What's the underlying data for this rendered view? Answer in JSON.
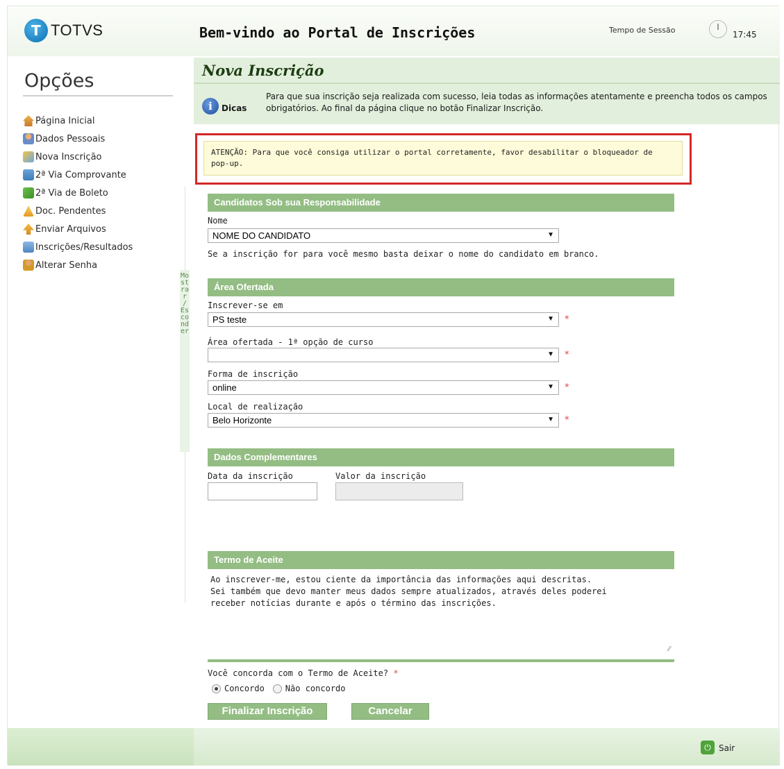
{
  "header": {
    "logo_text": "TOTVS",
    "welcome": "Bem-vindo ao Portal de Inscrições",
    "session_label": "Tempo de Sessão",
    "session_time": "17:45"
  },
  "sidebar": {
    "title": "Opções",
    "items": [
      {
        "label": "Página Inicial",
        "icon": "home-icon"
      },
      {
        "label": "Dados Pessoais",
        "icon": "user-icon"
      },
      {
        "label": "Nova Inscrição",
        "icon": "new-registration-icon"
      },
      {
        "label": "2ª Via Comprovante",
        "icon": "receipt-icon"
      },
      {
        "label": "2ª Via de Boleto",
        "icon": "boleto-icon"
      },
      {
        "label": "Doc. Pendentes",
        "icon": "pending-docs-icon"
      },
      {
        "label": "Enviar Arquivos",
        "icon": "upload-icon"
      },
      {
        "label": "Inscrições/Resultados",
        "icon": "results-icon"
      },
      {
        "label": "Alterar Senha",
        "icon": "key-icon"
      }
    ],
    "toggle_label": "Mostrar / Esconder"
  },
  "main": {
    "title": "Nova Inscrição",
    "tips_label": "Dicas",
    "tips_text": "Para que sua inscrição seja realizada com sucesso, leia todas as informações atentamente e preencha todos os campos obrigatórios. Ao final da página clique no botão Finalizar Inscrição.",
    "warning": "ATENÇÃO: Para que você consiga utilizar o portal corretamente, favor desabilitar o bloqueador de pop-up."
  },
  "candidates": {
    "section": "Candidatos Sob sua Responsabilidade",
    "name_label": "Nome",
    "name_value": "NOME DO CANDIDATO",
    "hint": "Se a inscrição for para você mesmo basta deixar o nome do candidato em branco."
  },
  "area": {
    "section": "Área Ofertada",
    "enroll_label": "Inscrever-se em",
    "enroll_value": "PS teste",
    "course_label": "Área ofertada - 1ª opção de curso",
    "course_value": "",
    "form_label": "Forma de inscrição",
    "form_value": "online",
    "location_label": "Local de realização",
    "location_value": "Belo Horizonte",
    "required_mark": "*"
  },
  "complementary": {
    "section": "Dados Complementares",
    "date_label": "Data da inscrição",
    "value_label": "Valor da inscrição"
  },
  "terms": {
    "section": "Termo de Aceite",
    "text_line1": "Ao inscrever-me, estou ciente da importância das informações aqui descritas.",
    "text_line2": "Sei também que devo manter meus dados sempre atualizados, através deles poderei",
    "text_line3": "receber notícias durante e após o término das inscrições.",
    "question": "Você concorda com o Termo de Aceite?",
    "agree": "Concordo",
    "disagree": "Não concordo",
    "selected": "Concordo"
  },
  "actions": {
    "finish": "Finalizar Inscrição",
    "cancel": "Cancelar"
  },
  "footer": {
    "logout": "Sair"
  },
  "colors": {
    "section_green": "#93bd83",
    "warning_border": "#d22727",
    "warning_bg": "#fdfbd9",
    "required": "#e0463c"
  }
}
